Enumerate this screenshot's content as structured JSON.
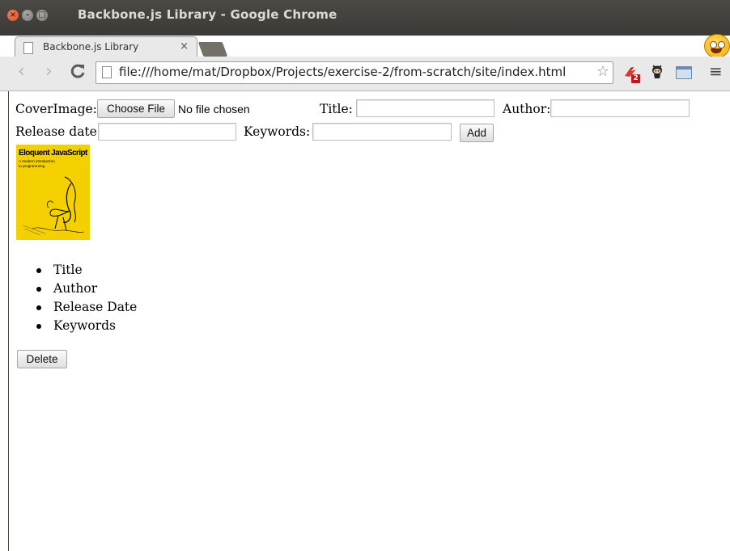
{
  "window": {
    "title": "Backbone.js Library - Google Chrome"
  },
  "tabs": [
    {
      "label": "Backbone.js Library",
      "close": "×"
    }
  ],
  "toolbar": {
    "back_glyph": "‹",
    "forward_glyph": "›",
    "url": "file:///home/mat/Dropbox/Projects/exercise-2/from-scratch/site/index.html",
    "star_glyph": "☆",
    "extension_badge": "2",
    "menu_glyph": "≡"
  },
  "form": {
    "cover_label": "CoverImage:",
    "choose_file_label": "Choose File",
    "no_file_text": "No file chosen",
    "title_label": "Title:",
    "title_value": "",
    "author_label": "Author:",
    "author_value": "",
    "release_label": "Release date:",
    "release_value": "",
    "keywords_label": "Keywords:",
    "keywords_value": "",
    "add_label": "Add"
  },
  "book": {
    "cover_title": "Eloquent JavaScript",
    "cover_subtitle_1": "A modern introduction",
    "cover_subtitle_2": "to programming",
    "fields": [
      "Title",
      "Author",
      "Release Date",
      "Keywords"
    ],
    "delete_label": "Delete"
  },
  "colors": {
    "titlebar": "#3b3a36",
    "toolbar": "#e9e9e9",
    "cover": "#f5d000",
    "close_button": "#df4a16"
  },
  "icons": {
    "reload": "reload-icon",
    "page": "page-icon",
    "star": "bookmark-star-icon",
    "menu": "menu-icon"
  }
}
